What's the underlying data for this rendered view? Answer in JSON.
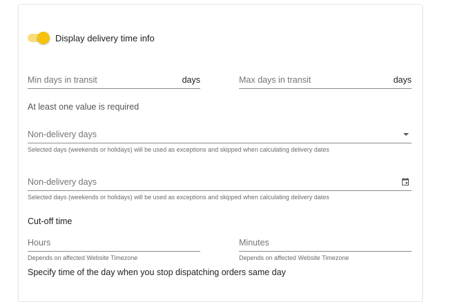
{
  "toggle": {
    "label": "Display delivery time info",
    "on": true
  },
  "transit": {
    "min_placeholder": "Min days in transit",
    "max_placeholder": "Max days in transit",
    "unit": "days",
    "required_msg": "At least one value is required"
  },
  "non_delivery_select": {
    "placeholder": "Non-delivery days",
    "helper": "Selected days (weekends or holidays) will be used as exceptions and skipped when calculating delivery dates"
  },
  "non_delivery_date": {
    "placeholder": "Non-delivery days",
    "helper": "Selected days (weekends or holidays) will be used as exceptions and skipped when calculating delivery dates"
  },
  "cutoff": {
    "title": "Cut-off time",
    "hours_placeholder": "Hours",
    "minutes_placeholder": "Minutes",
    "hours_helper": "Depends on affected Website Timezone",
    "minutes_helper": "Depends on affected Website Timezone",
    "description": "Specify time of the day when you stop dispatching orders same day"
  },
  "colors": {
    "accent": "#f4c20d",
    "accent_track": "#f7dc7a"
  }
}
